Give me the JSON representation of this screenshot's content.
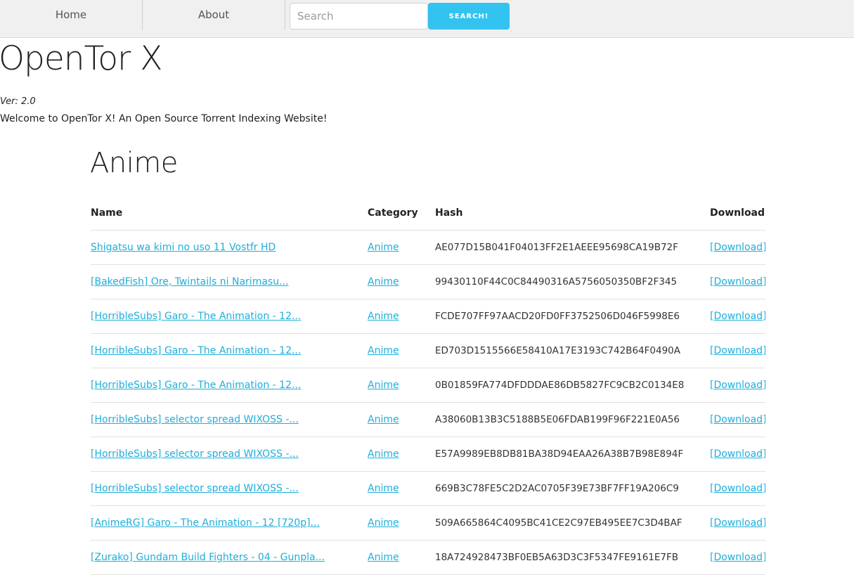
{
  "nav": {
    "home": "Home",
    "about": "About",
    "search_placeholder": "Search",
    "search_button": "SEARCH!"
  },
  "header": {
    "title": "OpenTor X",
    "version": "Ver: 2.0",
    "welcome": "Welcome to OpenTor X! An Open Source Torrent Indexing Website!"
  },
  "section": {
    "title": "Anime",
    "columns": [
      "Name",
      "Category",
      "Hash",
      "Download"
    ],
    "rows": [
      {
        "name": "Shigatsu wa kimi no uso 11 Vostfr HD",
        "category": "Anime",
        "hash": "AE077D15B041F04013FF2E1AEEE95698CA19B72F",
        "download": "[Download]"
      },
      {
        "name": "[BakedFish] Ore, Twintails ni Narimasu...",
        "category": "Anime",
        "hash": "99430110F44C0C84490316A5756050350BF2F345",
        "download": "[Download]"
      },
      {
        "name": "[HorribleSubs] Garo - The Animation - 12...",
        "category": "Anime",
        "hash": "FCDE707FF97AACD20FD0FF3752506D046F5998E6",
        "download": "[Download]"
      },
      {
        "name": "[HorribleSubs] Garo - The Animation - 12...",
        "category": "Anime",
        "hash": "ED703D1515566E58410A17E3193C742B64F0490A",
        "download": "[Download]"
      },
      {
        "name": "[HorribleSubs] Garo - The Animation - 12...",
        "category": "Anime",
        "hash": "0B01859FA774DFDDDAE86DB5827FC9CB2C0134E8",
        "download": "[Download]"
      },
      {
        "name": "[HorribleSubs] selector spread WIXOSS -...",
        "category": "Anime",
        "hash": "A38060B13B3C5188B5E06FDAB199F96F221E0A56",
        "download": "[Download]"
      },
      {
        "name": "[HorribleSubs] selector spread WIXOSS -...",
        "category": "Anime",
        "hash": "E57A9989EB8DB81BA38D94EAA26A38B7B98E894F",
        "download": "[Download]"
      },
      {
        "name": "[HorribleSubs] selector spread WIXOSS -...",
        "category": "Anime",
        "hash": "669B3C78FE5C2D2AC0705F39E73BF7FF19A206C9",
        "download": "[Download]"
      },
      {
        "name": "[AnimeRG] Garo - The Animation - 12 [720p]...",
        "category": "Anime",
        "hash": "509A665864C4095BC41CE2C97EB495EE7C3D4BAF",
        "download": "[Download]"
      },
      {
        "name": "[Zurako] Gundam Build Fighters - 04 - Gunpla...",
        "category": "Anime",
        "hash": "18A724928473BF0EB5A63D3C3F5347FE9161E7FB",
        "download": "[Download]"
      }
    ]
  }
}
